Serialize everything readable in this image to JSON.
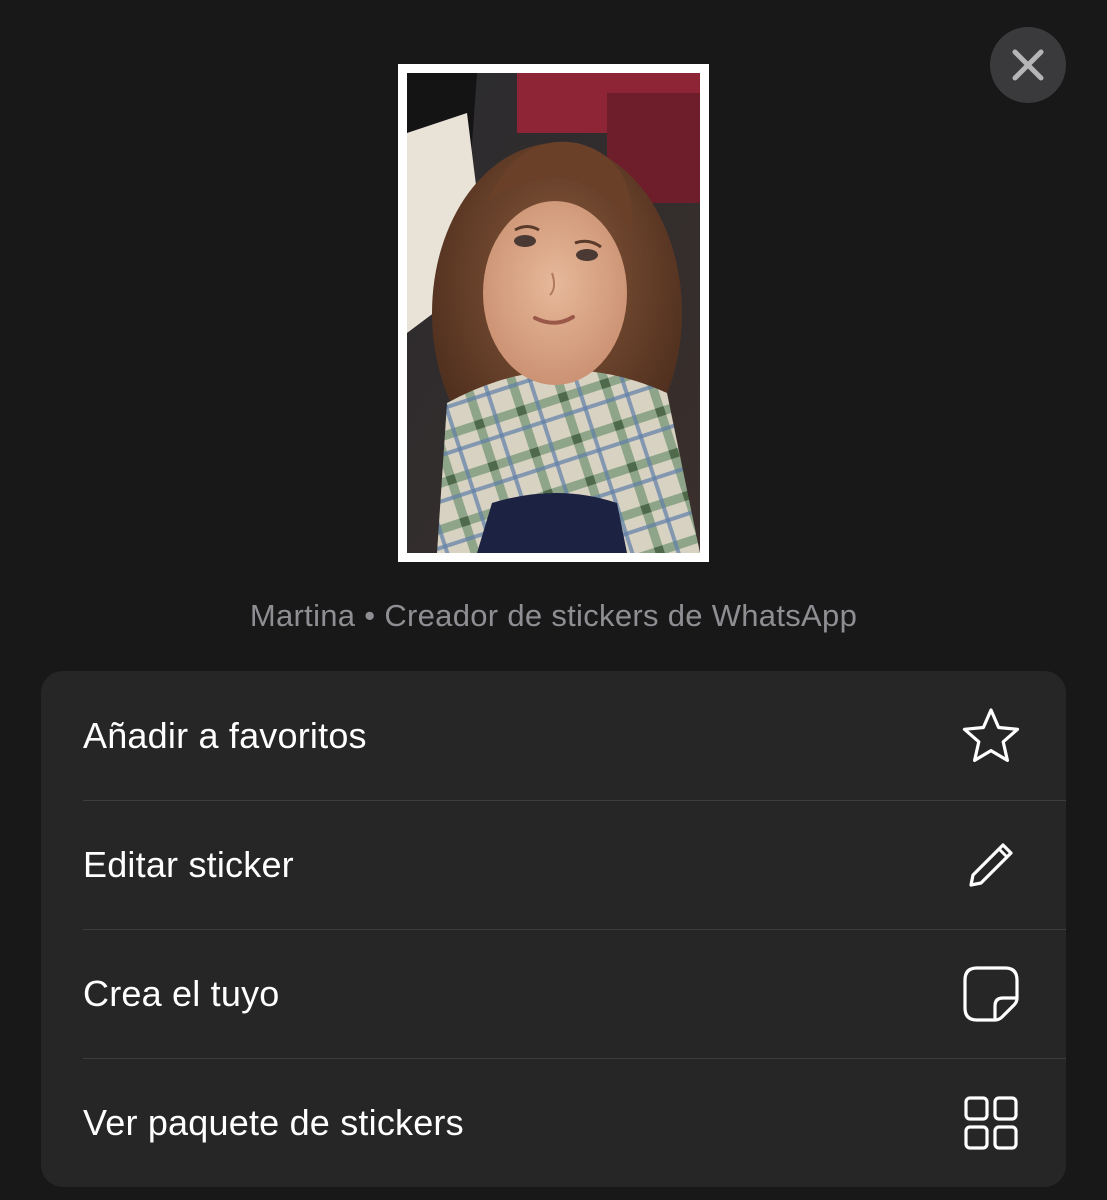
{
  "sheet": {
    "close_icon": "close-icon",
    "caption": "Martina • Creador de stickers de WhatsApp",
    "sticker_description": "sticker-photo"
  },
  "menu": {
    "items": [
      {
        "label": "Añadir a favoritos",
        "icon": "star-icon"
      },
      {
        "label": "Editar sticker",
        "icon": "pencil-icon"
      },
      {
        "label": "Crea el tuyo",
        "icon": "sticker-icon"
      },
      {
        "label": "Ver paquete de stickers",
        "icon": "grid-icon"
      }
    ]
  },
  "colors": {
    "background": "#181818",
    "menu_background": "#262626",
    "caption": "#8e8e93",
    "text": "#ffffff"
  }
}
